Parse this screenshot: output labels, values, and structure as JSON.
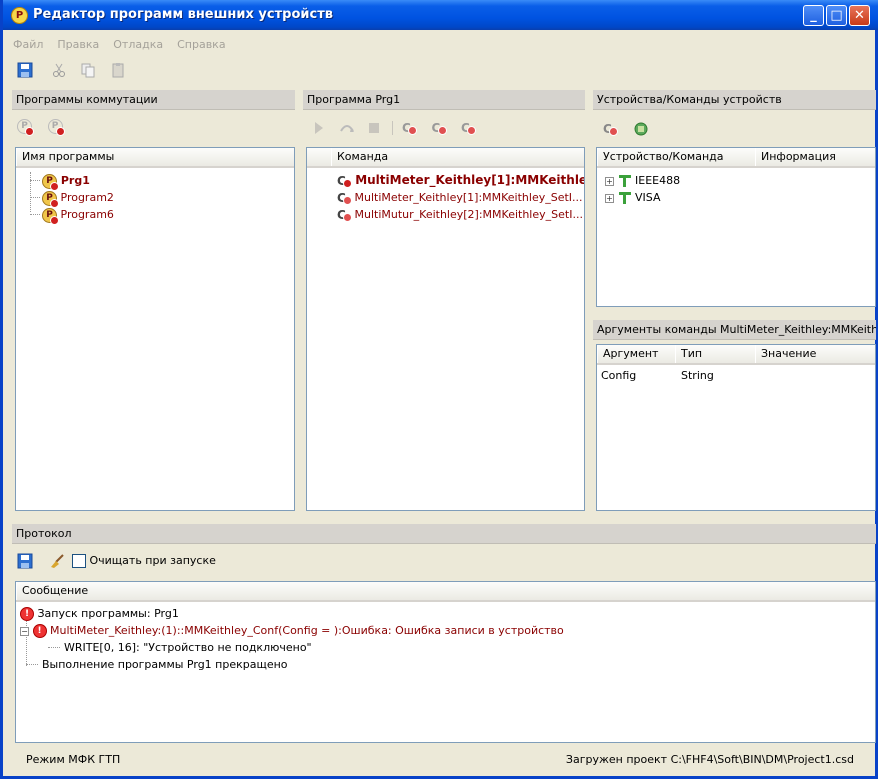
{
  "window": {
    "title": "Редактор программ внешних устройств",
    "app_icon_letter": "P"
  },
  "menu": [
    "Файл",
    "Правка",
    "Отладка",
    "Справка"
  ],
  "programs_panel": {
    "title": "Программы коммутации",
    "column": "Имя программы",
    "items": [
      "Prg1",
      "Program2",
      "Program6"
    ]
  },
  "program_panel": {
    "title": "Программа Prg1",
    "column": "Команда",
    "items": [
      "MultiMeter_Keithley[1]:MMKeithle...",
      "MultiMeter_Keithley[1]:MMKeithley_SetI...",
      "MultiMutur_Keithley[2]:MMKeithley_SetI..."
    ]
  },
  "devices_panel": {
    "title": "Устройства/Команды устройств",
    "columns": [
      "Устройство/Команда",
      "Информация"
    ],
    "items": [
      "IEEE488",
      "VISA"
    ]
  },
  "args_panel": {
    "title": "Аргументы команды MultiMeter_Keithley:MMKeithl...",
    "columns": [
      "Аргумент",
      "Тип",
      "Значение"
    ],
    "rows": [
      {
        "arg": "Config",
        "type": "String",
        "value": ""
      }
    ]
  },
  "protocol": {
    "title": "Протокол",
    "clear_on_start_label": "Очищать при запуске",
    "clear_on_start_checked": false,
    "column": "Сообщение",
    "messages": [
      "Запуск программы: Prg1",
      "MultiMeter_Keithley:(1)::MMKeithley_Conf(Config = ):Ошибка: Ошибка записи в устройство",
      "WRITE[0, 16]: \"Устройство не подключено\"",
      "Выполнение программы Prg1 прекращено"
    ]
  },
  "status": {
    "mode": "Режим МФК ГТП",
    "project": "Загружен проект C:\\FHF4\\Soft\\BIN\\DM\\Project1.csd"
  },
  "colors": {
    "title_blue": "#0053E1",
    "error_red": "#8A0000",
    "tree_green": "#3BA13B"
  }
}
